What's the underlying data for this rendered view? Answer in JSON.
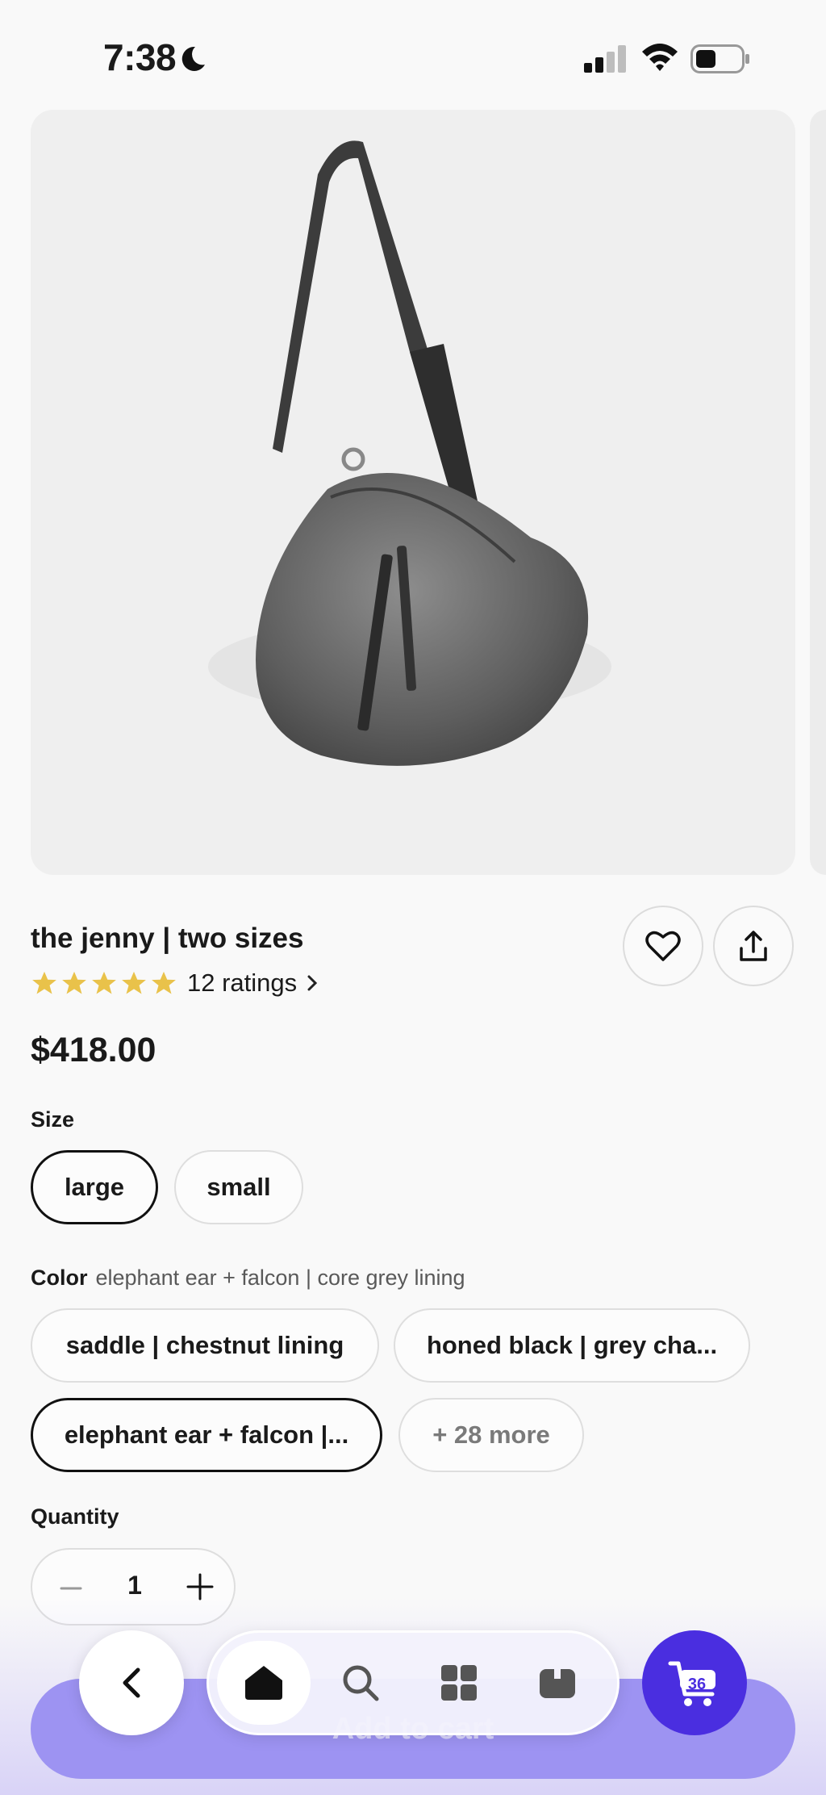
{
  "status_bar": {
    "time": "7:38"
  },
  "product": {
    "title": "the jenny | two sizes",
    "rating_count": "12 ratings",
    "stars": 5,
    "star_color": "#e9c24a",
    "price": "$418.00"
  },
  "size": {
    "label": "Size",
    "options": [
      "large",
      "small"
    ],
    "selected": "large"
  },
  "color": {
    "label": "Color",
    "selected_value": "elephant ear + falcon | core grey lining",
    "options": [
      "saddle | chestnut lining",
      "honed black | grey cha...",
      "elephant ear + falcon |..."
    ],
    "more": "+ 28 more"
  },
  "quantity": {
    "label": "Quantity",
    "value": "1"
  },
  "cta": {
    "add_to_cart": "Add to cart"
  },
  "nav": {
    "cart_count": "36",
    "accent": "#4a2ee0"
  }
}
